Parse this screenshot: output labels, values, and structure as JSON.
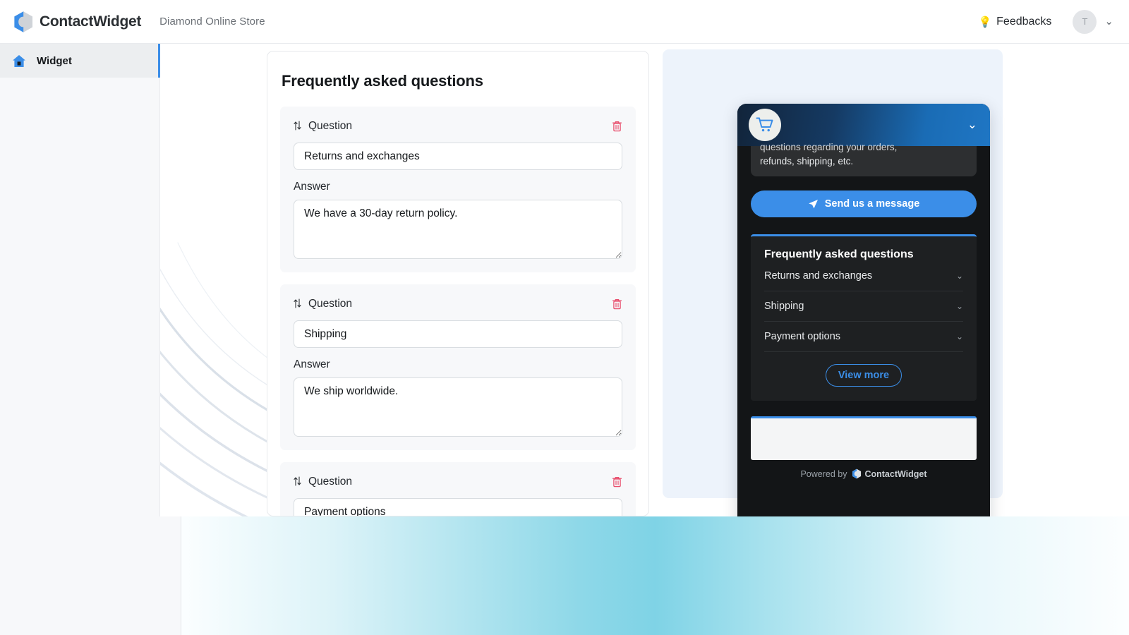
{
  "header": {
    "logo_icon": "contactwidget-logo-icon",
    "brand": "ContactWidget",
    "store_name": "Diamond Online Store",
    "feedbacks_label": "Feedbacks",
    "feedbacks_icon": "lightbulb-icon",
    "avatar_initial": "T",
    "caret_icon": "chevron-down-icon"
  },
  "sidebar": {
    "items": [
      {
        "label": "Widget",
        "icon": "home-icon",
        "active": true
      }
    ]
  },
  "editor": {
    "title": "Frequently asked questions",
    "question_label": "Question",
    "answer_label": "Answer",
    "drag_icon": "sort-updown-icon",
    "delete_icon": "trash-icon",
    "faqs": [
      {
        "question": "Returns and exchanges",
        "answer": "We have a 30-day return policy."
      },
      {
        "question": "Shipping",
        "answer": "We ship worldwide."
      },
      {
        "question": "Payment options",
        "answer": ""
      }
    ]
  },
  "preview": {
    "widget": {
      "avatar_icon": "shopping-cart-icon",
      "collapse_icon": "chevron-down-icon",
      "welcome_message_line1": "questions regarding your orders,",
      "welcome_message_line2": "refunds, shipping, etc.",
      "send_button_label": "Send us a message",
      "send_button_icon": "paper-plane-icon",
      "faq_title": "Frequently asked questions",
      "faq_items": [
        {
          "label": "Returns and exchanges",
          "chevron": "chevron-down-icon"
        },
        {
          "label": "Shipping",
          "chevron": "chevron-down-icon"
        },
        {
          "label": "Payment options",
          "chevron": "chevron-down-icon"
        }
      ],
      "view_more_label": "View more",
      "powered_by_label": "Powered by",
      "powered_by_brand": "ContactWidget",
      "powered_by_icon": "contactwidget-logo-icon"
    }
  },
  "colors": {
    "accent_blue": "#3b8ee8",
    "widget_dark": "#131517",
    "widget_card": "#1e2022",
    "danger_red": "#e8506e",
    "band_cyan": "#7fd3e6",
    "preview_bg": "#edf3fb"
  }
}
